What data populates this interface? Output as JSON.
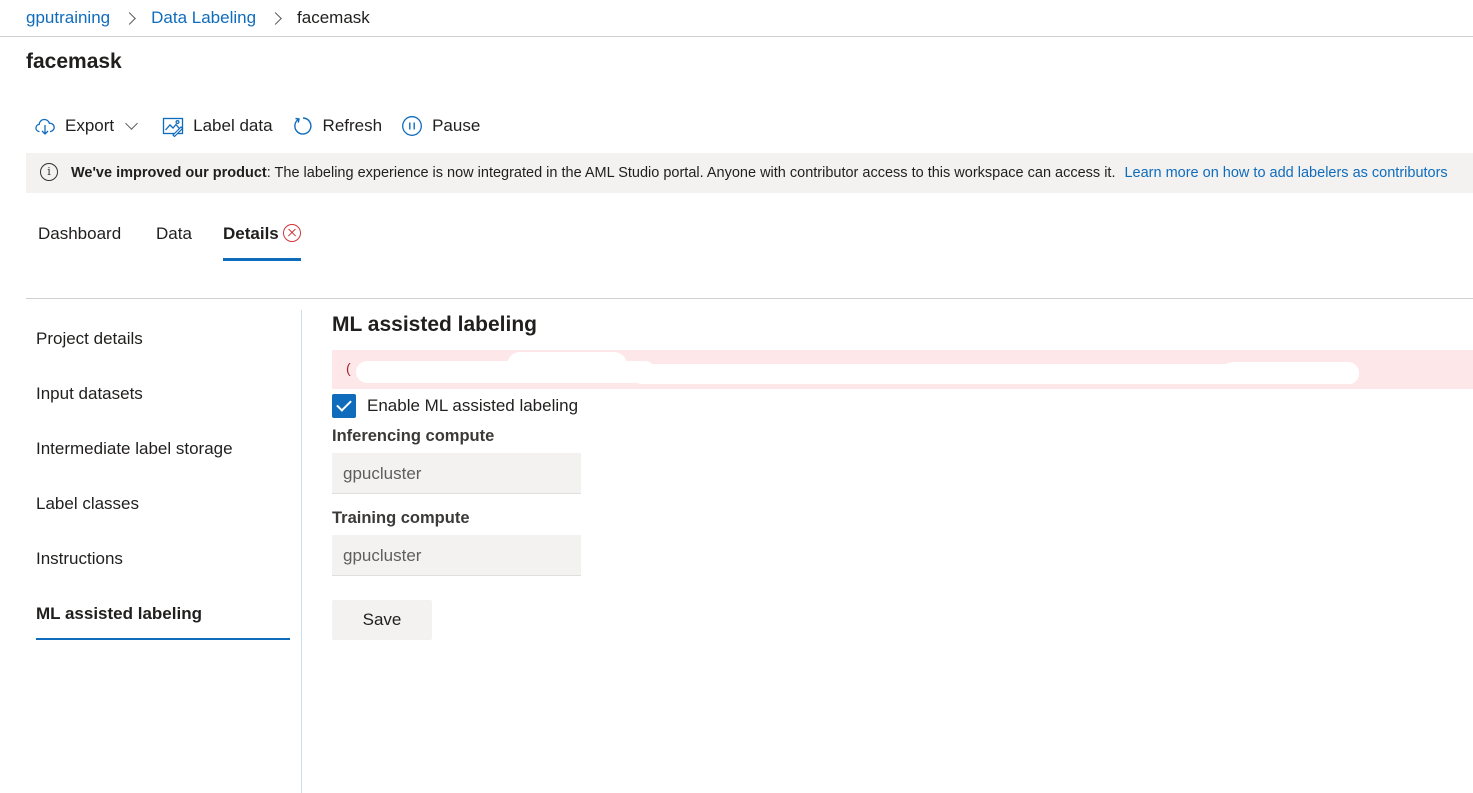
{
  "breadcrumb": {
    "items": [
      "gputraining",
      "Data Labeling"
    ],
    "current": "facemask"
  },
  "page": {
    "title": "facemask"
  },
  "toolbar": {
    "export_label": "Export",
    "label_data_label": "Label data",
    "refresh_label": "Refresh",
    "pause_label": "Pause"
  },
  "banner": {
    "bold": "We've improved our product",
    "text": ": The labeling experience is now integrated in the AML Studio portal. Anyone with contributor access to this workspace can access it.",
    "link": "Learn more on how to add labelers as contributors"
  },
  "tabs": [
    {
      "label": "Dashboard",
      "active": false
    },
    {
      "label": "Data",
      "active": false
    },
    {
      "label": "Details",
      "active": true,
      "has_error": true
    }
  ],
  "sidenav": {
    "items": [
      {
        "label": "Project details"
      },
      {
        "label": "Input datasets"
      },
      {
        "label": "Intermediate label storage"
      },
      {
        "label": "Label classes"
      },
      {
        "label": "Instructions"
      },
      {
        "label": "ML assisted labeling",
        "active": true
      }
    ]
  },
  "content": {
    "title": "ML assisted labeling",
    "error_text": "(",
    "enable_label": "Enable ML assisted labeling",
    "enable_checked": true,
    "inferencing_label": "Inferencing compute",
    "inferencing_value": "gpucluster",
    "training_label": "Training compute",
    "training_value": "gpucluster",
    "save_label": "Save"
  },
  "colors": {
    "accent": "#0f6cbd",
    "error": "#d13438",
    "error_bg": "#fde7e9",
    "banner_bg": "#f3f2f1"
  }
}
